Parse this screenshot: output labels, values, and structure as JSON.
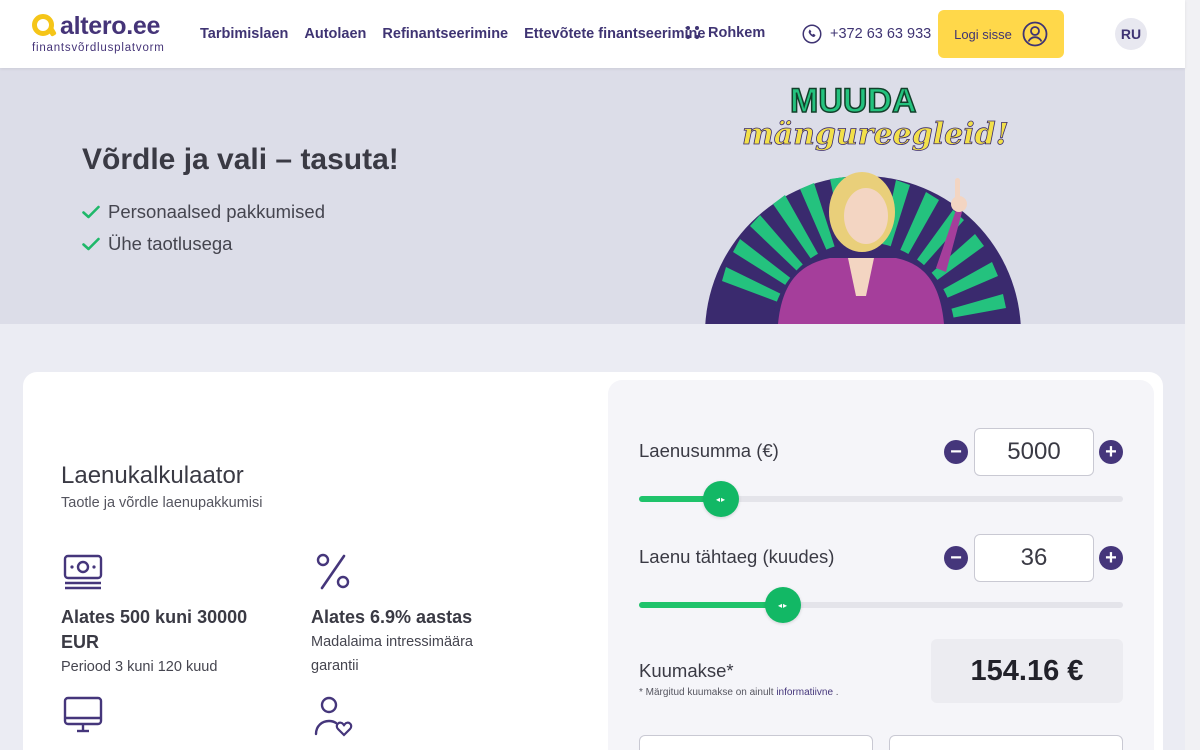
{
  "header": {
    "logo_name": "altero.ee",
    "logo_sub": "finantsvõrdlusplatvorm",
    "nav": [
      "Tarbimislaen",
      "Autolaen",
      "Refinantseerimine",
      "Ettevõtete finantseerimine"
    ],
    "more_label": "Rohkem",
    "phone": "+372 63 63 933",
    "login_label": "Logi sisse",
    "lang": "RU"
  },
  "hero": {
    "title": "Võrdle ja vali – tasuta!",
    "items": [
      "Personaalsed pakkumised",
      "Ühe taotlusega"
    ],
    "promo_line1": "MUUDA",
    "promo_line2": "mängureegleid!"
  },
  "calculator": {
    "title": "Laenukalkulaator",
    "subtitle": "Taotle ja võrdle laenupakkumisi",
    "features": [
      {
        "icon": "banknote-icon",
        "title": "Alates 500 kuni 30000 EUR",
        "desc": "Periood 3 kuni 120 kuud"
      },
      {
        "icon": "percent-icon",
        "title": "Alates 6.9% aastas",
        "desc": "Madalaima intressimäära garantii"
      },
      {
        "icon": "monitor-icon",
        "title": "",
        "desc": ""
      },
      {
        "icon": "user-heart-icon",
        "title": "",
        "desc": ""
      }
    ],
    "amount": {
      "label": "Laenusumma (€)",
      "value": "5000",
      "min": 500,
      "max": 30000
    },
    "term": {
      "label": "Laenu tähtaeg (kuudes)",
      "value": "36",
      "min": 3,
      "max": 120
    },
    "monthly_label": "Kuumakse*",
    "monthly_note": "* Märgitud kuumakse on ainult",
    "monthly_note_link": "informatiivne",
    "monthly_note_end": " .",
    "monthly_value": "154.16 €"
  },
  "colors": {
    "brand_purple": "#45367b",
    "accent_yellow": "#ffd84a",
    "slider_green": "#1fc36b"
  }
}
